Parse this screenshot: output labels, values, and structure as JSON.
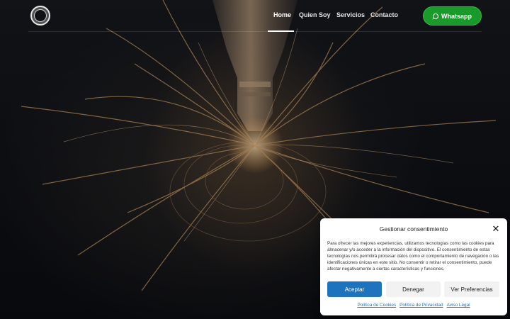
{
  "nav": {
    "items": [
      {
        "label": "Home",
        "active": true
      },
      {
        "label": "Quien Soy",
        "active": false
      },
      {
        "label": "Servicios",
        "active": false
      },
      {
        "label": "Contacto",
        "active": false
      }
    ],
    "whatsapp_label": "Whatsapp",
    "whatsapp_icon": "whatsapp-icon",
    "whatsapp_color": "#1b9a2c"
  },
  "cookie_banner": {
    "title": "Gestionar consentimiento",
    "close_icon": "close-icon",
    "body": "Para ofrecer las mejores experiencias, utilizamos tecnologías como las cookies para almacenar y/o acceder a la información del dispositivo. El consentimiento de estas tecnologías nos permitirá procesar datos como el comportamiento de navegación o las identificaciones únicas en este sitio. No consentir o retirar el consentimiento, puede afectar negativamente a ciertas características y funciones.",
    "accept_label": "Aceptar",
    "deny_label": "Denegar",
    "prefs_label": "Ver Preferencias",
    "accent_color": "#1e73be",
    "links": [
      "Política de Cookies",
      "Política de Privacidad",
      "Aviso Legal"
    ]
  }
}
